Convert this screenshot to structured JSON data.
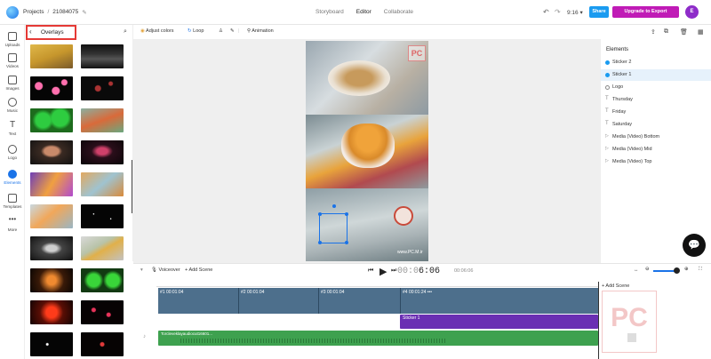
{
  "topbar": {
    "breadcrumb_root": "Projects",
    "breadcrumb_sep": "/",
    "project_id": "21084075",
    "mode_tabs": [
      "Storyboard",
      "Editor",
      "Collaborate"
    ],
    "undo": "↶",
    "redo": "↷",
    "time": "9:16",
    "share_label": "Share",
    "upgrade_label": "Upgrade to Export",
    "avatar_initial": "E",
    "colors": {
      "share": "#1a9bf0",
      "upgrade": "#c01bb6",
      "avatar": "#8e2cc9"
    }
  },
  "rail": {
    "items": [
      {
        "label": "Uploads",
        "icon": "upload-icon"
      },
      {
        "label": "Videos",
        "icon": "video-icon"
      },
      {
        "label": "Images",
        "icon": "image-icon"
      },
      {
        "label": "Music",
        "icon": "music-icon"
      },
      {
        "label": "Text",
        "icon": "text-icon"
      },
      {
        "label": "Logo",
        "icon": "logo-icon"
      },
      {
        "label": "Elements",
        "icon": "elements-icon"
      },
      {
        "label": "Templates",
        "icon": "templates-icon"
      },
      {
        "label": "More",
        "icon": "more-icon"
      }
    ],
    "active": "Elements"
  },
  "panel": {
    "title": "Overlays",
    "back_icon": "back-chevron-icon",
    "search_icon": "search-icon"
  },
  "toolbar": {
    "adjust_colors": "Adjust colors",
    "loop": "Loop",
    "animation": "Animation"
  },
  "canvas": {
    "watermark_text": "www.PC.M.ir"
  },
  "elements_panel": {
    "title": "Elements",
    "items": [
      {
        "label": "Sticker 2",
        "type": "sticker"
      },
      {
        "label": "Sticker 1",
        "type": "sticker"
      },
      {
        "label": "Logo",
        "type": "logo"
      },
      {
        "label": "Thursday",
        "type": "text"
      },
      {
        "label": "Friday",
        "type": "text"
      },
      {
        "label": "Saturday",
        "type": "text"
      },
      {
        "label": "Media (Video) Bottom",
        "type": "video"
      },
      {
        "label": "Media (Video) Mid",
        "type": "video"
      },
      {
        "label": "Media (Video) Top",
        "type": "video"
      }
    ],
    "selected": "Sticker 1"
  },
  "timeline": {
    "voiceover": "Voiceover",
    "add_scene": "Add Scene",
    "current_time_dim": "00:0",
    "current_time": "6:06",
    "total_time": "00:06:06",
    "scenes": [
      {
        "label": "#1",
        "duration": "00:01:04"
      },
      {
        "label": "#2",
        "duration": "00:01:04"
      },
      {
        "label": "#3",
        "duration": "00:01:04"
      },
      {
        "label": "#4",
        "duration": "00:01:24"
      }
    ],
    "sticker_track_label": "Sticker 1",
    "audio_track_label": "Torcleveklayaudiocut16601...",
    "add_scene_right": "+ Add Scene"
  }
}
